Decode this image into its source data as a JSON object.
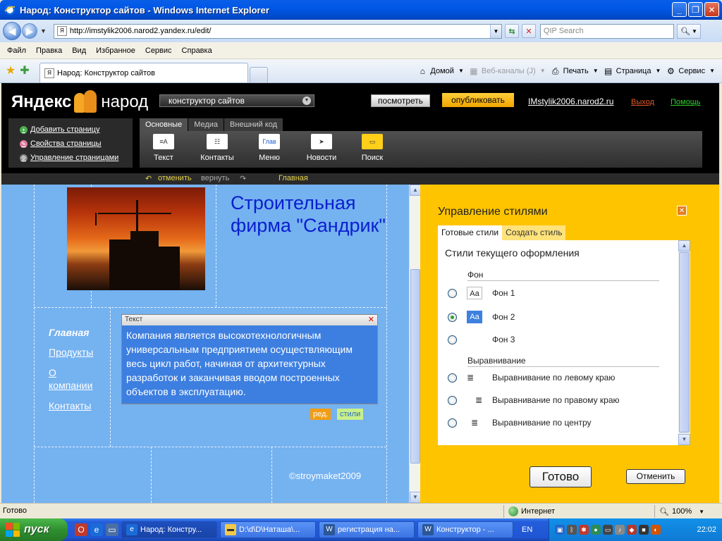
{
  "window": {
    "title": "Народ: Конструктор сайтов - Windows Internet Explorer",
    "controls": {
      "minimize": "_",
      "maximize": "❐",
      "close": "✕"
    }
  },
  "address": {
    "url": "http://imstylik2006.narod2.yandex.ru/edit/",
    "search_placeholder": "QIP Search"
  },
  "menubar": [
    "Файл",
    "Правка",
    "Вид",
    "Избранное",
    "Сервис",
    "Справка"
  ],
  "tab": {
    "title": "Народ: Конструктор сайтов"
  },
  "commands": {
    "home": "Домой",
    "feeds": "Веб-каналы (J)",
    "print": "Печать",
    "page": "Страница",
    "tools": "Сервис"
  },
  "yandex": {
    "logo_left": "Яндекс",
    "logo_right": "народ",
    "constructor_select": "конструктор сайтов",
    "view_btn": "посмотреть",
    "publish_btn": "опубликовать",
    "site_link": "IMstylik2006.narod2.ru",
    "logout": "Выход",
    "help": "Помощь",
    "left_menu": [
      "Добавить страницу",
      "Свойства страницы",
      "Управление страницами"
    ],
    "tabs": [
      "Основные",
      "Медиа",
      "Внешний код"
    ],
    "tools": [
      "Текст",
      "Контакты",
      "Меню",
      "Новости",
      "Поиск"
    ],
    "undo": "отменить",
    "redo": "вернуть",
    "current_page": "Главная"
  },
  "site": {
    "title": "Строительная фирма \"Сандрик\"",
    "nav": [
      "Главная",
      "Продукты",
      "О компании",
      "Контакты"
    ],
    "widget_title": "Текст",
    "widget_text": "Компания является высокотехнологичным универсальным предприятием осуществляющим весь цикл работ, начиная от архитектурных разработок и заканчивая вводом построенных объектов в эксплуатацию.",
    "edit_btn": "ред.",
    "styles_btn": "стили",
    "copyright": "©stroymaket2009"
  },
  "style_panel": {
    "title": "Управление стилями",
    "tabs": [
      "Готовые стили",
      "Создать стиль"
    ],
    "subtitle": "Стили текущего оформления",
    "bg_group": "Фон",
    "bg_options": [
      "Фон 1",
      "Фон 2",
      "Фон 3"
    ],
    "swatch_text": "Aa",
    "align_group": "Выравнивание",
    "align_options": [
      "Выравнивание по левому краю",
      "Выравнивание по правому краю",
      "Выравнивание по центру"
    ],
    "ok_btn": "Готово",
    "cancel_btn": "Отменить"
  },
  "status": {
    "left": "Готово",
    "zone": "Интернет",
    "zoom": "100%"
  },
  "taskbar": {
    "start": "пуск",
    "windows": [
      "Народ: Констру...",
      "D:\\d\\D\\Наташа\\...",
      "регистрация на...",
      "Конструктор - ..."
    ],
    "lang": "EN",
    "clock": "22:02"
  },
  "colors": {
    "canvas_bg": "#75b2f0",
    "panel_bg": "#ffc400",
    "title_link": "#0a1fd0",
    "publish": "#f0a500"
  }
}
